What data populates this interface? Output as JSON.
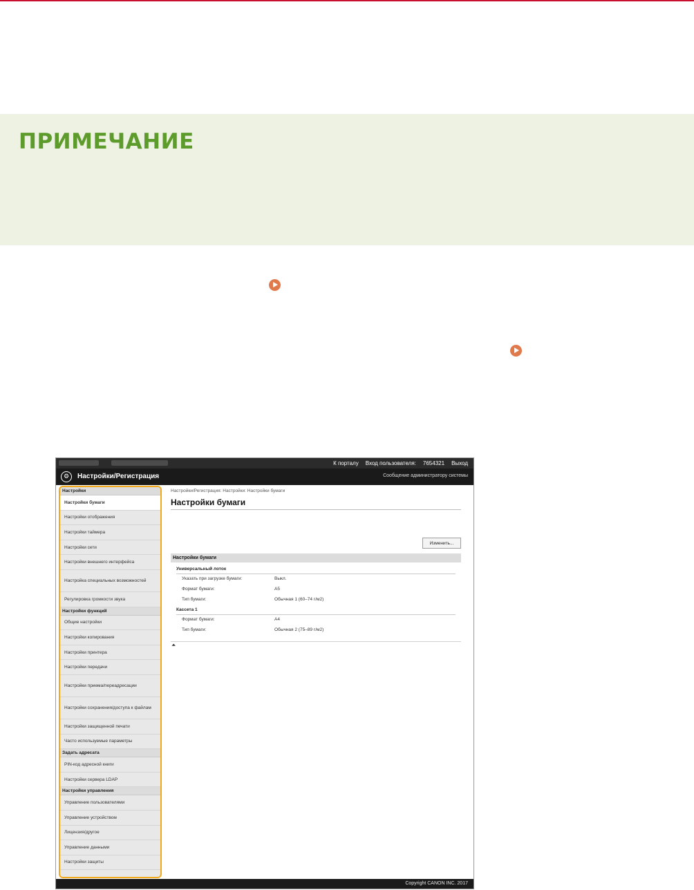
{
  "note": {
    "title": "ПРИМЕЧАНИЕ"
  },
  "screenshot": {
    "topbar": {
      "portal": "К порталу",
      "login_label": "Вход пользователя:",
      "login_id": "7654321",
      "logout": "Выход"
    },
    "titlebar": {
      "title": "Настройки/Регистрация",
      "admin_message": "Сообщение администратору системы"
    },
    "sidebar": {
      "sections": [
        {
          "title": "Настройки",
          "items": [
            "Настройки бумаги",
            "Настройки отображения",
            "Настройки таймера",
            "Настройки сети",
            "Настройки внешнего интерфейса",
            "Настройка специальных возможностей",
            "Регулировка громкости звука"
          ]
        },
        {
          "title": "Настройки функций",
          "items": [
            "Общие настройки",
            "Настройки копирования",
            "Настройки принтера",
            "Настройки передачи",
            "Настройки приема/переадресации",
            "Настройки сохранения/доступа к файлам",
            "Настройки защищенной печати",
            "Часто используемые параметры"
          ]
        },
        {
          "title": "Задать адресата",
          "items": [
            "PIN-код адресной книги",
            "Настройки сервера LDAP"
          ]
        },
        {
          "title": "Настройки управления",
          "items": [
            "Управление пользователями",
            "Управление устройством",
            "Лицензия/другое",
            "Управление данными",
            "Настройки защиты"
          ]
        }
      ]
    },
    "main": {
      "breadcrumb": "Настройки/Регистрация: Настройки: Настройки бумаги",
      "title": "Настройки бумаги",
      "edit_button": "Изменить...",
      "section_title": "Настройки бумаги",
      "groups": [
        {
          "title": "Универсальный лоток",
          "rows": [
            {
              "label": "Указать при загрузке бумаги:",
              "value": "Выкл."
            },
            {
              "label": "Формат бумаги:",
              "value": "A5"
            },
            {
              "label": "Тип бумаги:",
              "value": "Обычная 1 (60–74 г/м2)"
            }
          ]
        },
        {
          "title": "Кассета 1",
          "rows": [
            {
              "label": "Формат бумаги:",
              "value": "A4"
            },
            {
              "label": "Тип бумаги:",
              "value": "Обычная 2 (75–89 г/м2)"
            }
          ]
        }
      ]
    },
    "footer": {
      "copyright": "Copyright CANON INC. 2017"
    }
  }
}
